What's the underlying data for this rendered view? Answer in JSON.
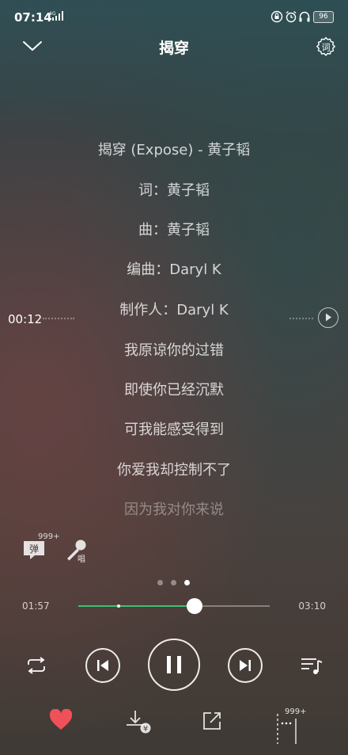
{
  "status_bar": {
    "time": "07:14",
    "network": "4G",
    "battery": "96"
  },
  "header": {
    "title": "揭穿",
    "settings_label": "词"
  },
  "lyrics": {
    "current_time": "00:12",
    "lines": [
      "揭穿 (Expose) - 黄子韬",
      "词：黄子韬",
      "曲：黄子韬",
      "编曲：Daryl K",
      "制作人：Daryl K",
      "我原谅你的过错",
      "即使你已经沉默",
      "可我能感受得到",
      "你爱我却控制不了",
      "因为我对你来说"
    ]
  },
  "extras": {
    "danmu_label": "弹",
    "danmu_count": "999+",
    "sing_label": "唱"
  },
  "pager": {
    "total": 3,
    "active_index": 2
  },
  "progress": {
    "elapsed": "01:57",
    "duration": "03:10",
    "played_fraction": 0.607,
    "buffered_marker_fraction": 0.21
  },
  "bottom": {
    "comment_count": "999+",
    "download_badge": "¥"
  },
  "colors": {
    "accent": "#3bbf72",
    "like": "#f0505a"
  }
}
